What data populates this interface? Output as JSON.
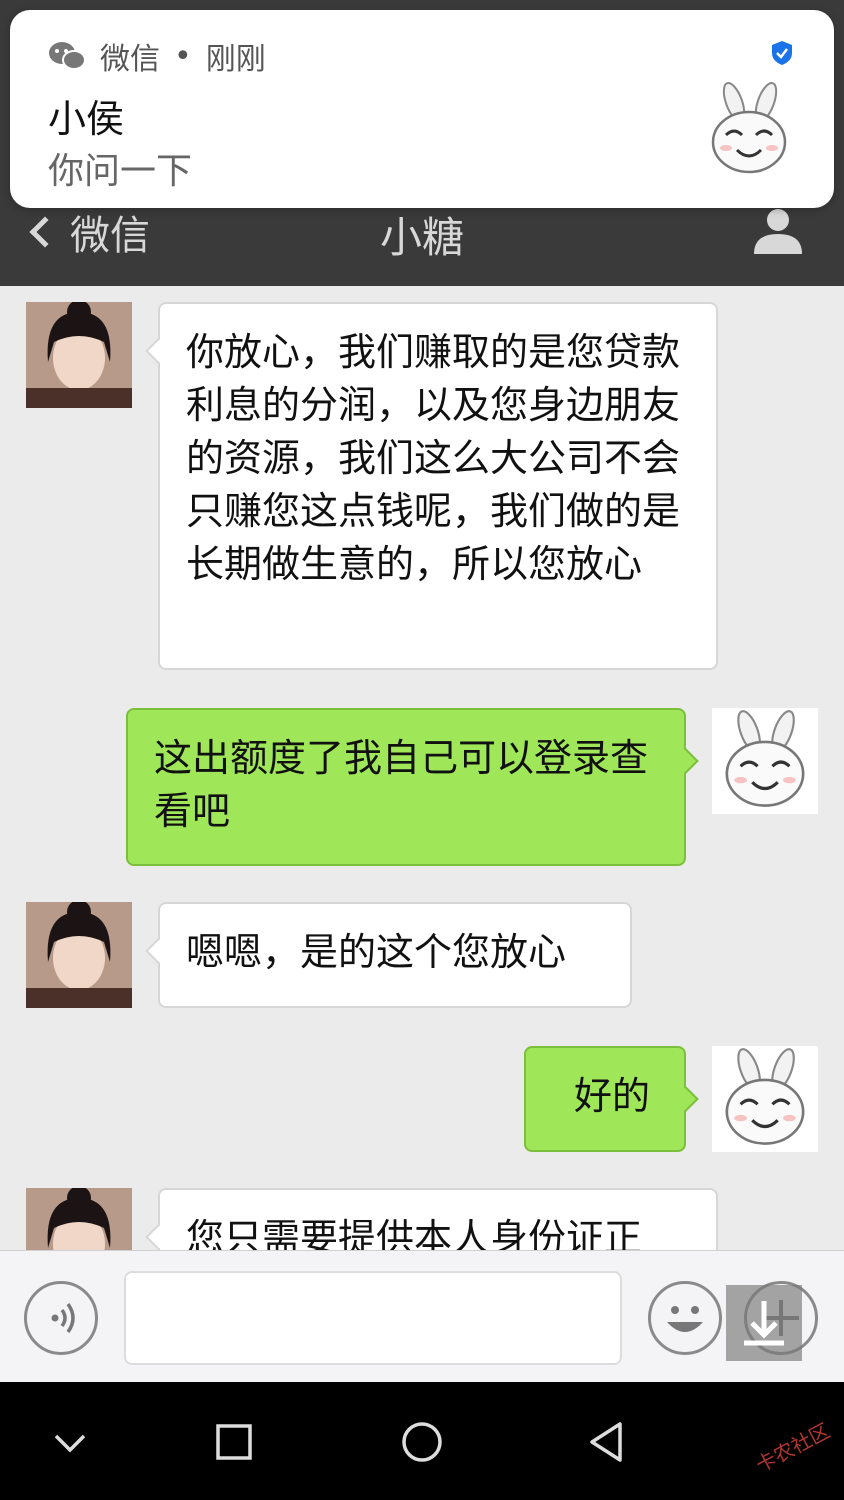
{
  "notification": {
    "app_name": "微信",
    "separator": "•",
    "time": "刚刚",
    "sender": "小侯",
    "message": "你问一下"
  },
  "header": {
    "back_label": "微信",
    "title": "小糖"
  },
  "messages": [
    {
      "side": "in",
      "text": "你放心，我们赚取的是您贷款利息的分润，以及您身边朋友的资源，我们这么大公司不会只赚您这点钱呢，我们做的是长期做生意的，所以您放心"
    },
    {
      "side": "out",
      "text": "这出额度了我自己可以登录查看吧"
    },
    {
      "side": "in",
      "text": "嗯嗯，是的这个您放心"
    },
    {
      "side": "out",
      "text": "好的"
    },
    {
      "side": "in",
      "text": "您只需要提供本人身份证正"
    }
  ],
  "input": {
    "value": "",
    "placeholder": ""
  },
  "watermark": "卡农社区",
  "colors": {
    "header_bg": "#3a3a3a",
    "chat_bg": "#ebebeb",
    "bubble_out": "#9fe658",
    "bubble_in": "#ffffff",
    "verify_blue": "#1a73e8"
  }
}
